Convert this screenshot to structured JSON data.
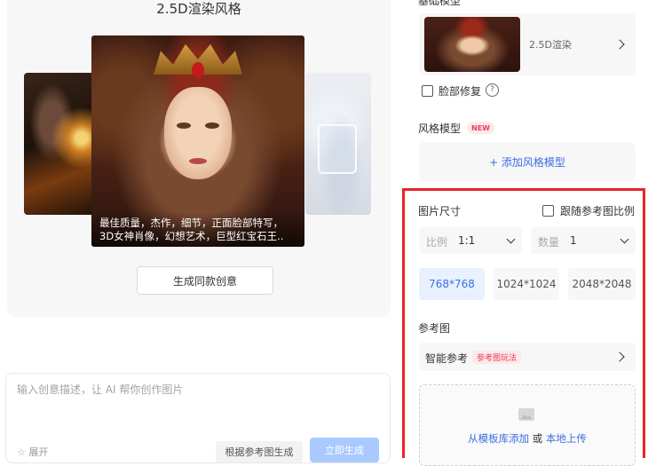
{
  "showcase": {
    "style_title": "2.5D渲染风格",
    "caption_line1": "最佳质量，杰作，细节，正面脸部特写，",
    "caption_line2": "3D女神肖像，幻想艺术，巨型红宝石王..",
    "generate_same_label": "生成同款创意"
  },
  "prompt": {
    "placeholder": "输入创意描述，让 AI 帮你创作图片",
    "expand_label": "☆ 展开",
    "ref_generate_label": "根据参考图生成",
    "generate_now_label": "立即生成"
  },
  "right": {
    "base_model_label": "基础模型",
    "model_name": "2.5D渲染",
    "face_fix_label": "脸部修复",
    "help_glyph": "?",
    "style_model_label": "风格模型",
    "new_badge": "NEW",
    "add_style_label": "+ 添加风格模型",
    "image_size_label": "图片尺寸",
    "follow_ratio_label": "跟随参考图比例",
    "ratio_label": "比例",
    "ratio_value": "1:1",
    "count_label": "数量",
    "count_value": "1",
    "sizes": [
      "768*768",
      "1024*1024",
      "2048*2048"
    ],
    "selected_size": "768*768",
    "reference_label": "参考图",
    "smart_ref_label": "智能参考",
    "ref_play_badge": "参考图玩法",
    "upload_from_template": "从模板库添加",
    "upload_or": " 或 ",
    "upload_local": "本地上传"
  },
  "colors": {
    "accent_blue": "#3b6fe0",
    "highlight_red": "#e8252a",
    "selected_bg": "#e9f1ff"
  }
}
